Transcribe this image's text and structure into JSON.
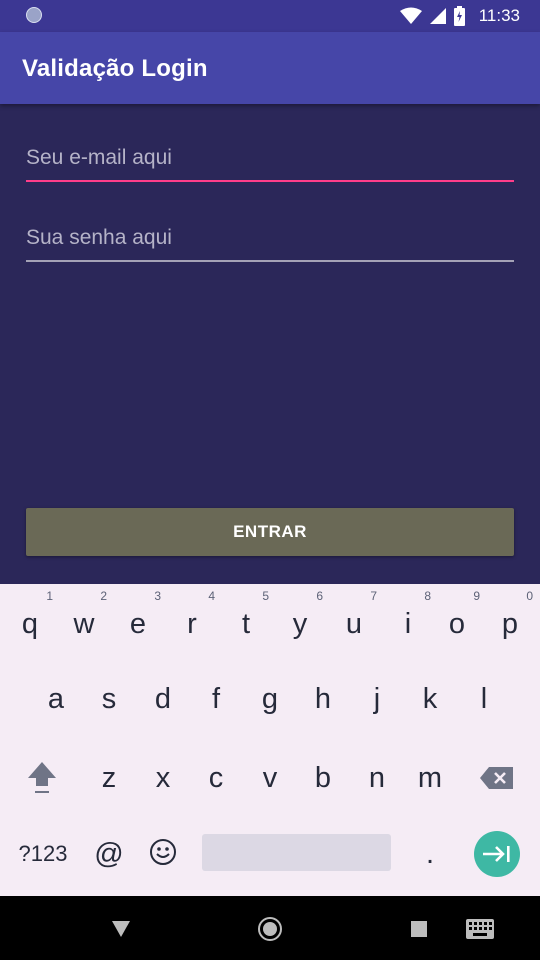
{
  "status_bar": {
    "time": "11:33",
    "icons": [
      "notification-dot-icon",
      "wifi-icon",
      "signal-icon",
      "battery-charging-icon"
    ]
  },
  "app_bar": {
    "title": "Validação Login"
  },
  "form": {
    "email_placeholder": "Seu e-mail aqui",
    "password_placeholder": "Sua senha aqui",
    "submit_label": "ENTRAR"
  },
  "keyboard": {
    "row1": [
      {
        "key": "q",
        "hint": "1"
      },
      {
        "key": "w",
        "hint": "2"
      },
      {
        "key": "e",
        "hint": "3"
      },
      {
        "key": "r",
        "hint": "4"
      },
      {
        "key": "t",
        "hint": "5"
      },
      {
        "key": "y",
        "hint": "6"
      },
      {
        "key": "u",
        "hint": "7"
      },
      {
        "key": "i",
        "hint": "8"
      },
      {
        "key": "o",
        "hint": "9"
      },
      {
        "key": "p",
        "hint": "0"
      }
    ],
    "row2": [
      "a",
      "s",
      "d",
      "f",
      "g",
      "h",
      "j",
      "k",
      "l"
    ],
    "row3": [
      "z",
      "x",
      "c",
      "v",
      "b",
      "n",
      "m"
    ],
    "symbols_label": "?123",
    "at_label": "@",
    "period_label": ".",
    "icons": {
      "shift": "shift-icon",
      "backspace": "backspace-icon",
      "emoji": "emoji-icon",
      "enter": "enter-icon"
    }
  },
  "nav_bar": {
    "icons": [
      "back-icon",
      "home-icon",
      "recents-icon",
      "keyboard-switch-icon"
    ]
  }
}
